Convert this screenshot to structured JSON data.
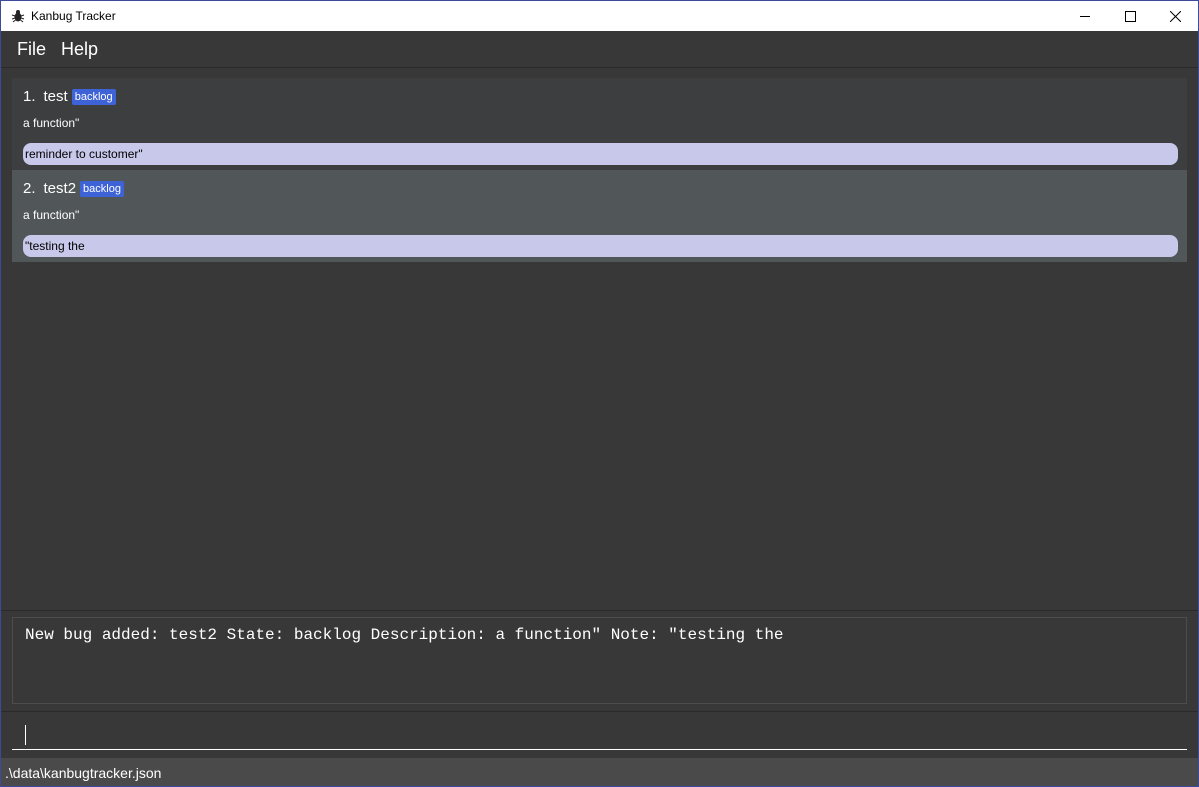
{
  "window": {
    "title": "Kanbug Tracker",
    "app_icon": "bug-icon"
  },
  "menu": {
    "items": [
      {
        "label": "File"
      },
      {
        "label": "Help"
      }
    ]
  },
  "bugs": [
    {
      "index": "1.",
      "name": "test",
      "state": "backlog",
      "description": "a function\"",
      "note": "reminder to customer\""
    },
    {
      "index": "2.",
      "name": "test2",
      "state": "backlog",
      "description": "a function\"",
      "note": "\"testing the"
    }
  ],
  "result": {
    "text": "New bug added: test2 State: backlog Description: a function\" Note: \"testing the"
  },
  "command": {
    "value": "",
    "placeholder": ""
  },
  "status": {
    "file_path": ".\\data\\kanbugtracker.json"
  },
  "colors": {
    "background": "#383838",
    "card_odd": "#3c3e3f",
    "card_even": "#515658",
    "state_badge": "#3e63d6",
    "note_bg": "#c8c8ea",
    "status_bar": "#4a4a4a"
  }
}
